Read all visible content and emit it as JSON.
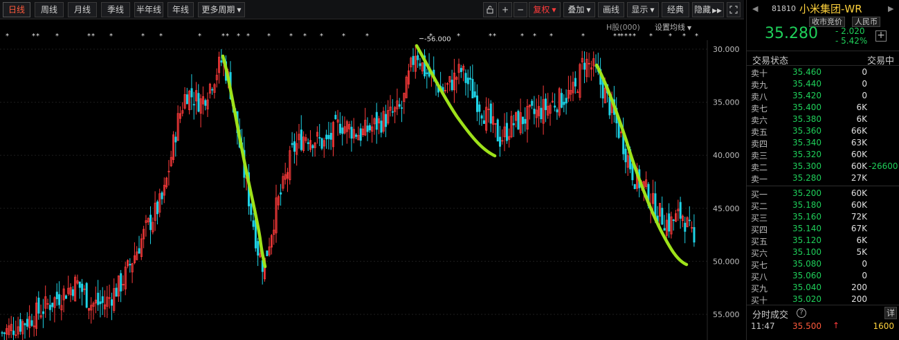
{
  "toolbar": {
    "periods": [
      "日线",
      "周线",
      "月线",
      "季线",
      "半年线",
      "年线"
    ],
    "more_periods": "更多周期",
    "restore": "复权",
    "overlay": "叠加",
    "draw": "画线",
    "display": "显示",
    "classic": "经典",
    "hide": "隐藏",
    "plus": "+",
    "minus": "−",
    "lock_icon": "lock-icon",
    "expand_icon": "fullscreen-icon"
  },
  "chart": {
    "ma_label": "H股(000)",
    "ma_setting": "设置均线",
    "high_marker": "56.000",
    "y_ticks": [
      "55.000",
      "50.000",
      "45.000",
      "40.000",
      "35.000",
      "30.000"
    ],
    "colors": {
      "up": "#ff3b3b",
      "down": "#1fd3e6",
      "annotation": "#9ee21a",
      "grid": "#1e1e1e"
    }
  },
  "chart_data": {
    "type": "candlestick",
    "ylim": [
      28,
      58
    ],
    "yticks": [
      30,
      35,
      40,
      45,
      50,
      55
    ],
    "marked_high": 56.0,
    "last_close": 35.28,
    "trend_sketch": [
      {
        "from": 55.0,
        "to": 34.5
      },
      {
        "from": 56.0,
        "to": 45.5
      },
      {
        "from": 54.0,
        "to": 34.7
      }
    ]
  },
  "quote": {
    "code": "81810",
    "name": "小米集团-WR",
    "tag1": "收市竞价",
    "tag2": "人民币",
    "price": "35.280",
    "change": "- 2.020",
    "change_pct": "- 5.42%",
    "status_label": "交易状态",
    "status_value": "交易中"
  },
  "asks": [
    {
      "label": "卖十",
      "price": "35.460",
      "vol": "0"
    },
    {
      "label": "卖九",
      "price": "35.440",
      "vol": "0"
    },
    {
      "label": "卖八",
      "price": "35.420",
      "vol": "0"
    },
    {
      "label": "卖七",
      "price": "35.400",
      "vol": "6K"
    },
    {
      "label": "卖六",
      "price": "35.380",
      "vol": "6K"
    },
    {
      "label": "卖五",
      "price": "35.360",
      "vol": "66K"
    },
    {
      "label": "卖四",
      "price": "35.340",
      "vol": "63K"
    },
    {
      "label": "卖三",
      "price": "35.320",
      "vol": "60K"
    },
    {
      "label": "卖二",
      "price": "35.300",
      "vol": "60K",
      "ext": "-26600"
    },
    {
      "label": "卖一",
      "price": "35.280",
      "vol": "27K"
    }
  ],
  "bids": [
    {
      "label": "买一",
      "price": "35.200",
      "vol": "60K"
    },
    {
      "label": "买二",
      "price": "35.180",
      "vol": "60K"
    },
    {
      "label": "买三",
      "price": "35.160",
      "vol": "72K"
    },
    {
      "label": "买四",
      "price": "35.140",
      "vol": "67K"
    },
    {
      "label": "买五",
      "price": "35.120",
      "vol": "6K"
    },
    {
      "label": "买六",
      "price": "35.100",
      "vol": "5K"
    },
    {
      "label": "买七",
      "price": "35.080",
      "vol": "0"
    },
    {
      "label": "买八",
      "price": "35.060",
      "vol": "0"
    },
    {
      "label": "买九",
      "price": "35.040",
      "vol": "200"
    },
    {
      "label": "买十",
      "price": "35.020",
      "vol": "200"
    }
  ],
  "ticks": {
    "title": "分时成交",
    "detail": "详",
    "rows": [
      {
        "time": "11:47",
        "price": "35.500",
        "arrow": "↑",
        "vol": "1600"
      }
    ]
  }
}
